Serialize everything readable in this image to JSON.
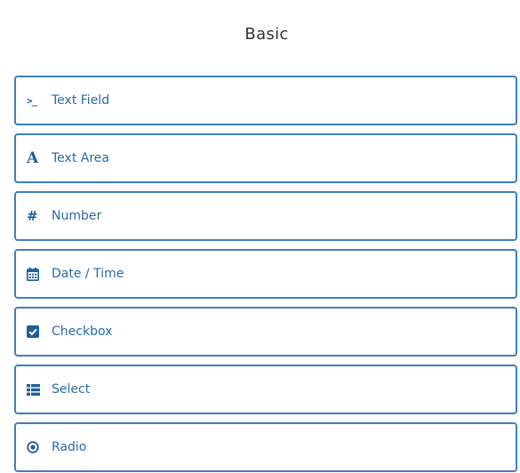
{
  "panel": {
    "title": "Basic"
  },
  "components": [
    {
      "label": "Text Field",
      "icon": "terminal-icon"
    },
    {
      "label": "Text Area",
      "icon": "font-icon"
    },
    {
      "label": "Number",
      "icon": "hashtag-icon"
    },
    {
      "label": "Date / Time",
      "icon": "calendar-icon"
    },
    {
      "label": "Checkbox",
      "icon": "check-square-icon"
    },
    {
      "label": "Select",
      "icon": "th-list-icon"
    },
    {
      "label": "Radio",
      "icon": "dot-circle-icon"
    }
  ],
  "colors": {
    "border": "#3f7fbd",
    "text": "#2a6aa6",
    "icon": "#1f5f99",
    "title": "#333333"
  }
}
